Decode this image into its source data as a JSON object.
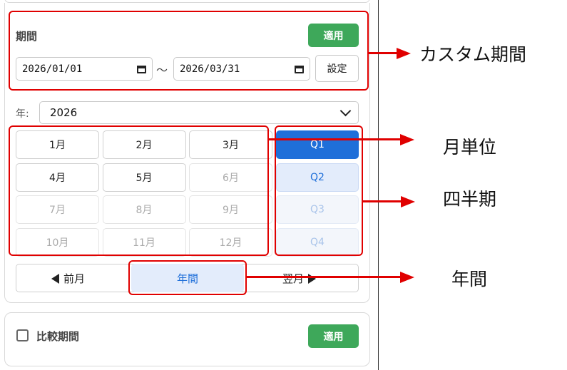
{
  "period_card": {
    "label": "期間",
    "apply_label": "適用",
    "start_date": "2026/01/01",
    "end_date": "2026/03/31",
    "tilde": "〜",
    "set_label": "設定"
  },
  "year_select": {
    "label": "年:",
    "value": "2026"
  },
  "months": [
    {
      "label": "1月",
      "enabled": true
    },
    {
      "label": "2月",
      "enabled": true
    },
    {
      "label": "3月",
      "enabled": true
    },
    {
      "label": "4月",
      "enabled": true
    },
    {
      "label": "5月",
      "enabled": true
    },
    {
      "label": "6月",
      "enabled": false
    },
    {
      "label": "7月",
      "enabled": false
    },
    {
      "label": "8月",
      "enabled": false
    },
    {
      "label": "9月",
      "enabled": false
    },
    {
      "label": "10月",
      "enabled": false
    },
    {
      "label": "11月",
      "enabled": false
    },
    {
      "label": "12月",
      "enabled": false
    }
  ],
  "quarters": [
    {
      "label": "Q1",
      "state": "active"
    },
    {
      "label": "Q2",
      "state": "available"
    },
    {
      "label": "Q3",
      "state": "disabled"
    },
    {
      "label": "Q4",
      "state": "disabled"
    }
  ],
  "nav": {
    "prev_label": "前月",
    "year_label": "年間",
    "next_label": "翌月"
  },
  "compare_card": {
    "label": "比較期間",
    "checked": false,
    "apply_label": "適用"
  },
  "annotations": {
    "custom_period": "カスタム期間",
    "monthly": "月単位",
    "quarterly": "四半期",
    "yearly": "年間"
  },
  "colors": {
    "apply_green": "#3ea85a",
    "accent_blue": "#1f6fd9",
    "annotation_red": "#e00000"
  }
}
